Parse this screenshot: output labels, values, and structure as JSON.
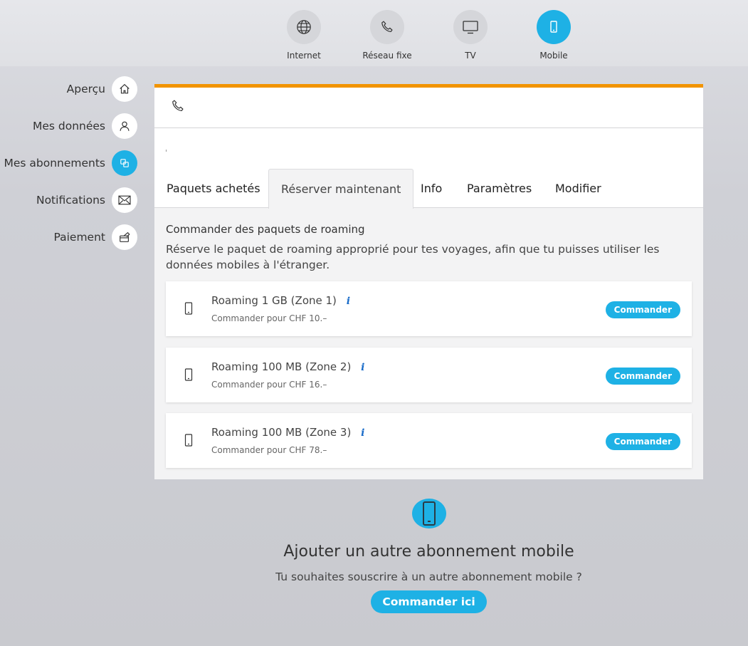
{
  "top_nav": {
    "items": [
      {
        "label": "Internet",
        "icon": "globe-icon"
      },
      {
        "label": "Réseau fixe",
        "icon": "phone-icon"
      },
      {
        "label": "TV",
        "icon": "tv-icon"
      },
      {
        "label": "Mobile",
        "icon": "mobile-icon",
        "active": true
      }
    ]
  },
  "side_nav": {
    "items": [
      {
        "label": "Aperçu",
        "icon": "home-icon"
      },
      {
        "label": "Mes données",
        "icon": "user-icon"
      },
      {
        "label": "Mes abonnements",
        "icon": "subscriptions-icon",
        "active": true
      },
      {
        "label": "Notifications",
        "icon": "envelope-icon"
      },
      {
        "label": "Paiement",
        "icon": "payment-icon"
      }
    ]
  },
  "card": {
    "header_icon": "phone-icon",
    "tabs": [
      {
        "label": "Paquets achetés"
      },
      {
        "label": "Réserver maintenant",
        "active": true
      },
      {
        "label": "Info"
      },
      {
        "label": "Paramètres"
      },
      {
        "label": "Modifier"
      }
    ],
    "section_title": "Commander des paquets de roaming",
    "section_desc": "Réserve le paquet de roaming approprié pour tes voyages, afin que tu puisses utiliser les données mobiles à l'étranger.",
    "packages": [
      {
        "name": "Roaming 1 GB (Zone 1)",
        "info": "i",
        "price": "Commander pour CHF 10.–",
        "button": "Commander"
      },
      {
        "name": "Roaming 100 MB (Zone 2)",
        "info": "i",
        "price": "Commander pour CHF 16.–",
        "button": "Commander"
      },
      {
        "name": "Roaming 100 MB (Zone 3)",
        "info": "i",
        "price": "Commander pour CHF 78.–",
        "button": "Commander"
      }
    ]
  },
  "add_subscription": {
    "icon": "mobile-icon",
    "title": "Ajouter un autre abonnement mobile",
    "desc": "Tu souhaites souscrire à un autre abonnement mobile ?",
    "button": "Commander ici"
  },
  "colors": {
    "accent": "#1eb1e5",
    "card_top_border": "#f29400",
    "info_icon": "#1a6cc9"
  }
}
